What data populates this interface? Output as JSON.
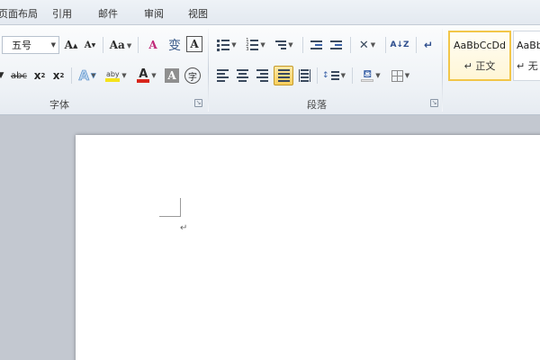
{
  "tabs": {
    "page_layout": "页面布局",
    "references": "引用",
    "mailings": "邮件",
    "review": "审阅",
    "view": "视图"
  },
  "font_group": {
    "label": "字体",
    "font_size": "五号",
    "grow_font": "A",
    "shrink_font": "A",
    "change_case": "Aa",
    "clear_format": "A",
    "phonetic": "变",
    "char_border": "A",
    "strikethrough": "abc",
    "subscript": "x",
    "superscript": "x",
    "text_effect": "A",
    "highlight": "aby",
    "font_color": "A",
    "char_shading": "A",
    "enclose": "字"
  },
  "paragraph_group": {
    "label": "段落",
    "sort": "A↓Z",
    "show_marks": "↵"
  },
  "styles_group": {
    "items": [
      {
        "sample": "AaBbCcDd",
        "name": "↵ 正文"
      },
      {
        "sample": "AaBbC",
        "name": "↵ 无"
      }
    ]
  },
  "document": {
    "paragraph_mark": "↵"
  },
  "colors": {
    "highlight_yellow": "#f5e31a",
    "font_color_red": "#d8261c",
    "selection_gold": "#f2c649"
  }
}
